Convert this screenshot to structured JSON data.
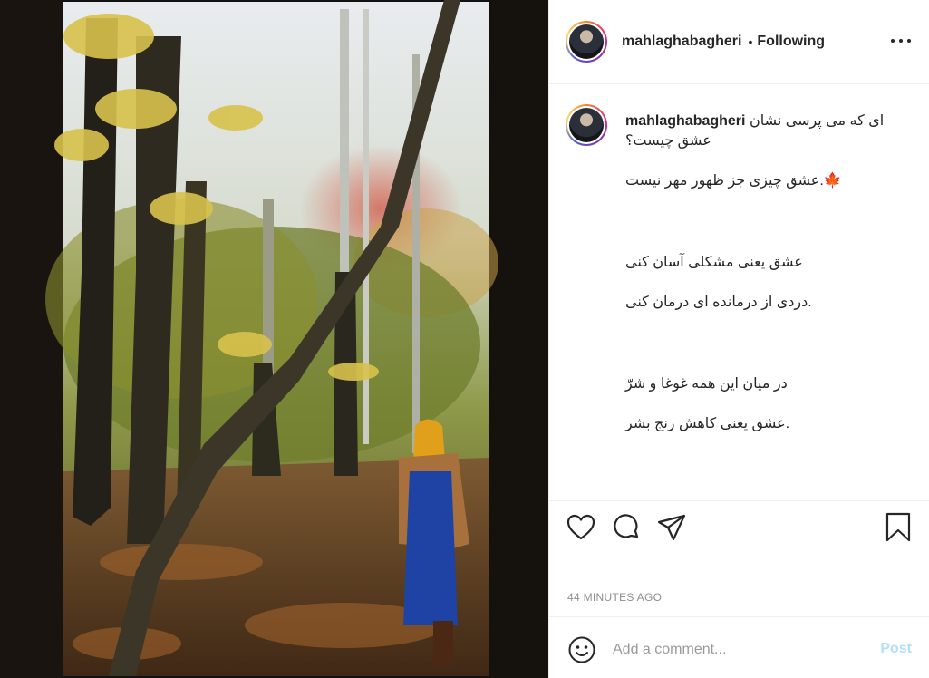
{
  "post": {
    "username": "mahlaghabagheri",
    "follow_state": "Following",
    "separator": "•",
    "caption_lines": [
      "ای که می پرسی نشان",
      "عشق چیست؟",
      "عشق چیزی جز ظهور مهر نیست.",
      "عشق یعنی مشکلی آسان کنی",
      "دردی از درمانده ای درمان کنی.",
      "در میان این همه غوغا و شرّ",
      "عشق یعنی کاهش رنج بشر."
    ],
    "leaf_emoji": "🍁",
    "timestamp": "44 MINUTES AGO"
  },
  "comment": {
    "placeholder": "Add a comment...",
    "post_label": "Post"
  },
  "icons": {
    "like": "heart-icon",
    "comment": "comment-icon",
    "share": "paper-plane-icon",
    "save": "bookmark-icon",
    "more": "more-options-icon",
    "emoji": "smiley-icon"
  },
  "colors": {
    "text": "#262626",
    "muted": "#8e8e8e",
    "post_button": "#b2dffc",
    "border": "#efefef"
  }
}
